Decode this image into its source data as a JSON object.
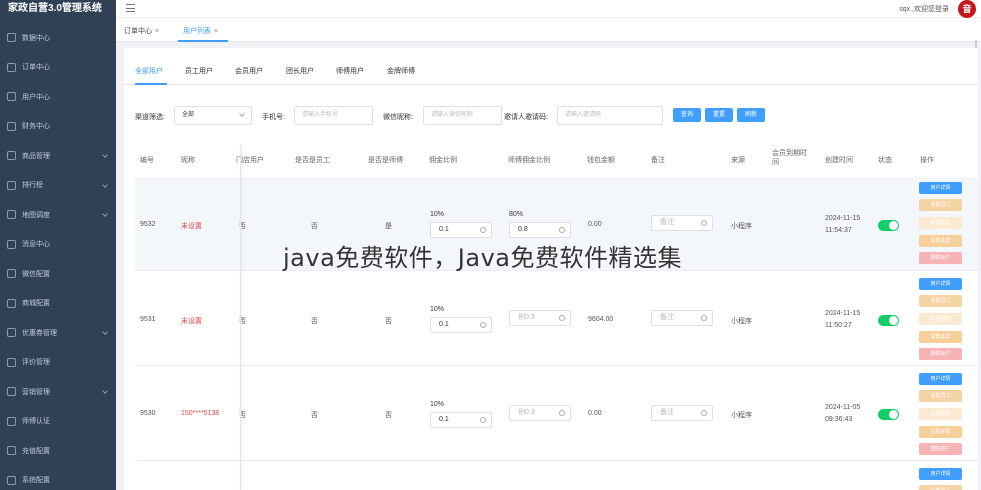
{
  "app": {
    "title": "家政自营3.0管理系统"
  },
  "sidebar": {
    "items": [
      {
        "label": "数据中心",
        "arrow": false
      },
      {
        "label": "订单中心",
        "arrow": false
      },
      {
        "label": "用户中心",
        "arrow": false
      },
      {
        "label": "财务中心",
        "arrow": false
      },
      {
        "label": "商品管理",
        "arrow": true
      },
      {
        "label": "排行榜",
        "arrow": true
      },
      {
        "label": "地图调度",
        "arrow": true
      },
      {
        "label": "消息中心",
        "arrow": false
      },
      {
        "label": "微信配置",
        "arrow": false
      },
      {
        "label": "商城配置",
        "arrow": false
      },
      {
        "label": "优惠券管理",
        "arrow": true
      },
      {
        "label": "评价管理",
        "arrow": false
      },
      {
        "label": "营销管理",
        "arrow": true
      },
      {
        "label": "师傅认证",
        "arrow": false
      },
      {
        "label": "充值配置",
        "arrow": false
      },
      {
        "label": "系统配置",
        "arrow": false
      }
    ]
  },
  "header": {
    "user_text": "sqx ,欢迎您登录",
    "avatar_text": "音"
  },
  "tags": [
    {
      "label": "订单中心",
      "close": "×"
    },
    {
      "label": "用户列表",
      "close": "×"
    }
  ],
  "tabs": [
    "全部用户",
    "员工用户",
    "会员用户",
    "团长用户",
    "师傅用户",
    "金牌师傅"
  ],
  "filters": {
    "channel_label": "渠道筛选:",
    "channel_value": "全部",
    "phone_label": "手机号:",
    "phone_placeholder": "请输入手机号",
    "nickname_label": "微信昵称:",
    "nickname_placeholder": "请输入微信昵称",
    "invite_label": "邀请人邀请码:",
    "invite_placeholder": "请输入邀请码",
    "buttons": {
      "query": "查询",
      "reset": "重置",
      "refresh": "刷新"
    }
  },
  "table": {
    "headers": {
      "id": "编号",
      "nickname": "昵称",
      "store_user": "门店用户",
      "is_staff": "是否是员工",
      "is_master": "是否是师傅",
      "commission": "佣金比例",
      "master_commission": "师傅佣金比例",
      "wallet": "钱包金额",
      "remark": "备注",
      "source": "来源",
      "member_expire": "会员到期时间",
      "created": "创建时间",
      "status": "状态",
      "ops": "操作"
    },
    "ops_labels": {
      "detail": "用户详情",
      "staff": "设置员工",
      "leader": "设置团长",
      "member": "设置会员",
      "delete": "删除用户"
    },
    "rows": [
      {
        "id": "9532",
        "nickname": "未设置",
        "store": "否",
        "is_staff": "否",
        "is_master": "是",
        "commission_pct": "10%",
        "commission": "0.1",
        "master_pct": "80%",
        "master_value": "0.8",
        "master_placeholder": "",
        "wallet": "0.00",
        "remark_placeholder": "备注",
        "source": "小程序",
        "created_date": "2024-11-15",
        "created_time": "11:54:37"
      },
      {
        "id": "9531",
        "nickname": "未设置",
        "store": "否",
        "is_staff": "否",
        "is_master": "否",
        "commission_pct": "10%",
        "commission": "0.1",
        "master_pct": "",
        "master_value": "",
        "master_placeholder": "例0.3",
        "wallet": "9604.00",
        "remark_placeholder": "备注",
        "source": "小程序",
        "created_date": "2024-11-15",
        "created_time": "11:50:27"
      },
      {
        "id": "9530",
        "nickname": "150****5138",
        "store": "否",
        "is_staff": "否",
        "is_master": "否",
        "commission_pct": "10%",
        "commission": "0.1",
        "master_pct": "",
        "master_value": "",
        "master_placeholder": "例0.3",
        "wallet": "0.00",
        "remark_placeholder": "备注",
        "source": "小程序",
        "created_date": "2024-11-05",
        "created_time": "09:36:43"
      }
    ]
  },
  "watermark": "java免费软件，Java免费软件精选集",
  "colors": {
    "sidebar": "#304156",
    "primary": "#409eff",
    "switch_on": "#13ce66",
    "danger_text": "#e04848"
  }
}
